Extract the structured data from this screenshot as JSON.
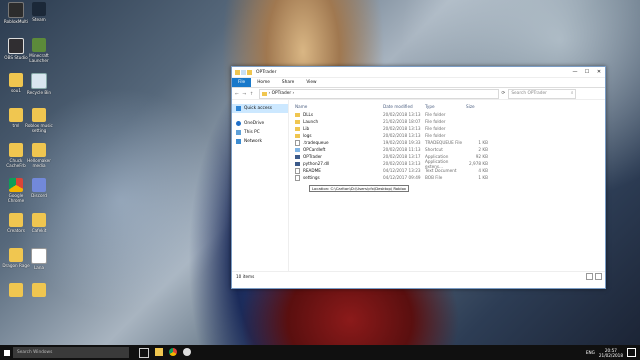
{
  "desktop": {
    "icons": [
      {
        "label": "RobloxMulti",
        "kind": "app"
      },
      {
        "label": "Steam",
        "kind": "steam"
      },
      {
        "label": "OBS Studio",
        "kind": "obs"
      },
      {
        "label": "Minecraft Launcher",
        "kind": "mc"
      },
      {
        "label": "sou1",
        "kind": "folder"
      },
      {
        "label": "Recycle Bin",
        "kind": "bin"
      },
      {
        "label": "tml",
        "kind": "folder"
      },
      {
        "label": "Roblox music setting",
        "kind": "folder"
      },
      {
        "label": "Chuck CacheFrb",
        "kind": "folder"
      },
      {
        "label": "Hellomaker media",
        "kind": "folder"
      },
      {
        "label": "Google Chrome",
        "kind": "chrome"
      },
      {
        "label": "Discord",
        "kind": "discord"
      },
      {
        "label": "Creators",
        "kind": "folder"
      },
      {
        "label": "Cafekit",
        "kind": "folder"
      },
      {
        "label": "Dragon Rage",
        "kind": "folder"
      },
      {
        "label": "Lana",
        "kind": "doc"
      },
      {
        "label": "",
        "kind": "folder"
      },
      {
        "label": "",
        "kind": "folder"
      }
    ]
  },
  "window": {
    "title": "OPTrader",
    "controls": {
      "minimize": "—",
      "maximize": "☐",
      "close": "✕"
    },
    "ribbon_tabs": [
      "File",
      "Home",
      "Share",
      "View"
    ],
    "address": {
      "path": "› OPTrader ›"
    },
    "search_placeholder": "Search OPTrader",
    "nav": [
      {
        "label": "Quick access",
        "icon": "star-icon"
      },
      {
        "label": "OneDrive",
        "icon": "cloud-icon"
      },
      {
        "label": "This PC",
        "icon": "computer-icon"
      },
      {
        "label": "Network",
        "icon": "network-icon"
      }
    ],
    "columns": {
      "name": "Name",
      "date": "Date modified",
      "type": "Type",
      "size": "Size"
    },
    "files": [
      {
        "name": "DLLs",
        "date": "20/02/2018 13:13",
        "type": "File folder",
        "size": "",
        "icon": "folder"
      },
      {
        "name": "Launch",
        "date": "21/02/2018 18:07",
        "type": "File folder",
        "size": "",
        "icon": "folder"
      },
      {
        "name": "Lib",
        "date": "20/02/2018 13:13",
        "type": "File folder",
        "size": "",
        "icon": "folder"
      },
      {
        "name": "logs",
        "date": "20/02/2018 13:13",
        "type": "File folder",
        "size": "",
        "icon": "folder"
      },
      {
        "name": ".tradequeue",
        "date": "19/02/2018 19:33",
        "type": "TRADEQUEUE File",
        "size": "1 KB",
        "icon": "file"
      },
      {
        "name": "OPCardleft",
        "date": "20/02/2018 11:13",
        "type": "Shortcut",
        "size": "2 KB",
        "icon": "shortcut"
      },
      {
        "name": "OPTrader",
        "date": "20/02/2018 13:17",
        "type": "Application",
        "size": "92 KB",
        "icon": "app"
      },
      {
        "name": "python27.dll",
        "date": "20/02/2018 13:13",
        "type": "Application extens...",
        "size": "2,978 KB",
        "icon": "app"
      },
      {
        "name": "README",
        "date": "04/12/2017 13:23",
        "type": "Text Document",
        "size": "4 KB",
        "icon": "file"
      },
      {
        "name": "settings",
        "date": "04/12/2017 09:49",
        "type": "BOB File",
        "size": "1 KB",
        "icon": "file"
      }
    ],
    "tooltip": "Location: C:\\Carlton\\D:\\Users\\cfx\\Desktop\\ Roblox",
    "status": "10 items"
  },
  "taskbar": {
    "search_placeholder": "Search Windows",
    "tray_lang": "ENG",
    "time": "20:57",
    "date": "21/02/2018"
  }
}
